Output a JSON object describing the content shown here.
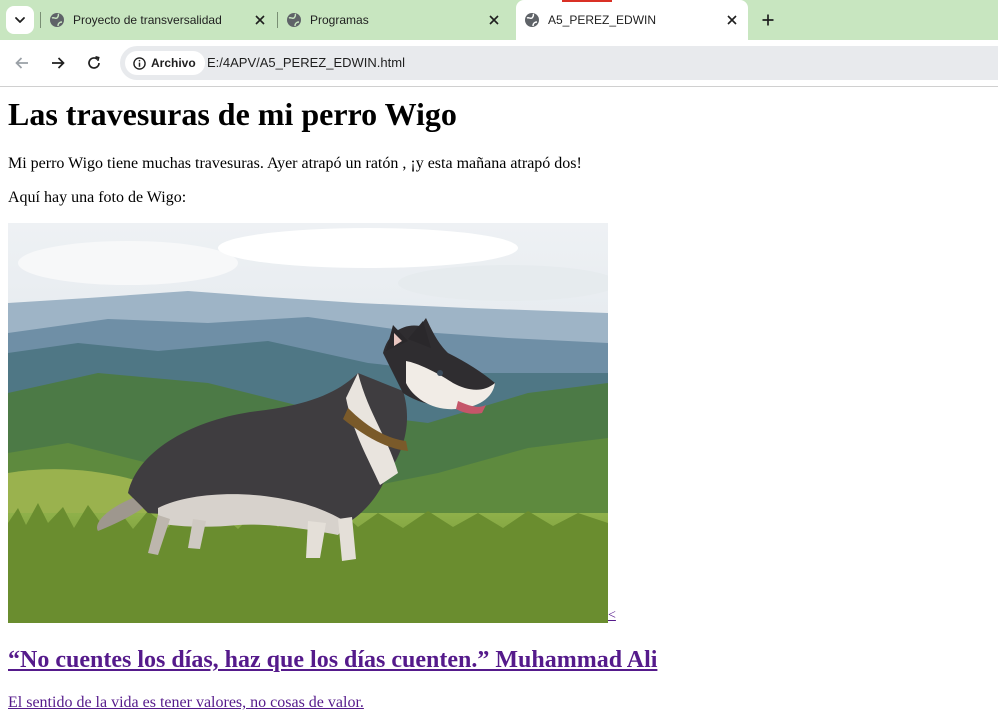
{
  "browser": {
    "tabs": [
      {
        "title": "Proyecto de transversalidad",
        "active": false
      },
      {
        "title": "Programas",
        "active": false
      },
      {
        "title": "A5_PEREZ_EDWIN",
        "active": true
      }
    ],
    "site_info_label": "Archivo",
    "url": "E:/4APV/A5_PEREZ_EDWIN.html",
    "colors": {
      "tabstrip": "#c8e6c0",
      "omnibox": "#e8eaed",
      "visited_link": "#551a8b"
    },
    "icons": {
      "tab_menu": "chevron-down-icon",
      "favicon": "globe-icon",
      "close": "close-icon",
      "new_tab": "plus-icon",
      "back": "back-arrow-icon",
      "forward": "forward-arrow-icon",
      "reload": "reload-icon",
      "info": "info-icon"
    }
  },
  "page": {
    "heading": "Las travesuras de mi perro Wigo",
    "paragraph1": "Mi perro Wigo tiene muchas travesuras. Ayer atrapó un ratón , ¡y esta mañana atrapó dos!",
    "paragraph2": "Aquí hay una foto de Wigo:",
    "image_subject": "Husky dog standing on a grassy mountain meadow",
    "stray_link_text": "<",
    "quote_link": "“No cuentes los días, haz que los días cuenten.” Muhammad Ali",
    "sentence_link": "El sentido de la vida es tener valores, no cosas de valor."
  }
}
